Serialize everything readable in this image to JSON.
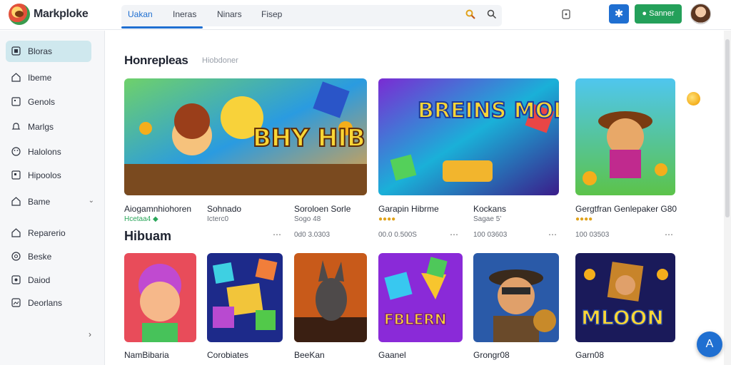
{
  "app": {
    "brand": "Markploke"
  },
  "header": {
    "tabs": [
      {
        "label": "Uakan",
        "active": true
      },
      {
        "label": "Ineras",
        "active": false
      },
      {
        "label": "Ninars",
        "active": false
      },
      {
        "label": "Fisep",
        "active": false
      }
    ],
    "signin_label": "Sanner",
    "icon_button_glyph": "✱"
  },
  "sidebar": {
    "items": [
      {
        "label": "Bloras",
        "icon": "square-icon",
        "active": true
      },
      {
        "label": "Ibeme",
        "icon": "home-icon"
      },
      {
        "label": "Genols",
        "icon": "grid-icon"
      },
      {
        "label": "Marlgs",
        "icon": "bell-icon"
      },
      {
        "label": "Halolons",
        "icon": "smiley-icon"
      },
      {
        "label": "Hipoolos",
        "icon": "image-icon"
      },
      {
        "label": "Bame",
        "icon": "home-icon",
        "chevron": "⌄"
      },
      {
        "label": "Reparerio",
        "icon": "home-icon"
      },
      {
        "label": "Beske",
        "icon": "smiley-icon"
      },
      {
        "label": "Daiod",
        "icon": "image-icon"
      },
      {
        "label": "Deorlans",
        "icon": "image-icon"
      }
    ],
    "collapse_glyph": "›"
  },
  "main": {
    "featured_title": "Honrepleas",
    "featured_subtitle": "Hiobdoner",
    "section2_title": "Hibuam",
    "featured": [
      {
        "title": "Aiogamnhiohoren",
        "sub": "Hcetaa4 ◆",
        "art_text": "BHY HIBUAKA"
      },
      {
        "title": "Sohnado",
        "sub": "Icterc0"
      },
      {
        "title": "Soroloen Sorle",
        "sub": "Sogo 48"
      },
      {
        "title": "Garapin Hibrme",
        "sub": "●●●●",
        "art_text": "BREINS MOLEAYS"
      },
      {
        "title": "Kockans",
        "sub": "Sagae 5’"
      },
      {
        "title": "Gergtfran Genlepaker G80",
        "sub": "●●●●"
      }
    ],
    "featured_meta": [
      {
        "text": "0d0 3.0303",
        "more": "⋯"
      },
      {
        "text": "00.0 0.500S",
        "more": "⋯"
      },
      {
        "text": "100 03603",
        "more": "⋯"
      },
      {
        "text": "100 03503",
        "more": "⋯"
      }
    ],
    "games": [
      {
        "title": "NamBibaria"
      },
      {
        "title": "Corobiates"
      },
      {
        "title": "BeeKan"
      },
      {
        "title": "Gaanel",
        "art_text": "FBLERN"
      },
      {
        "title": "Grongr08"
      },
      {
        "title": "Garn08",
        "art_text": "MLOON"
      }
    ],
    "fab_label": "A"
  }
}
